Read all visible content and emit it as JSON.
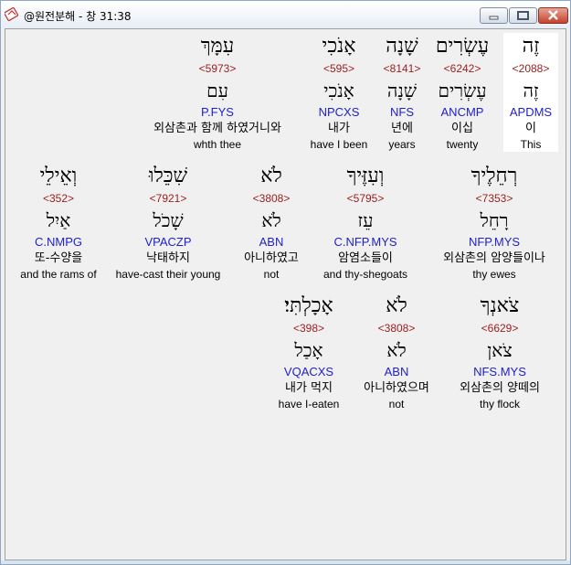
{
  "window": {
    "title": "@원전분해 - 창 31:38",
    "icon": "app-logo-icon",
    "buttons": [
      "minimize-icon",
      "maximize-icon",
      "close-icon"
    ]
  },
  "rows": [
    [
      {
        "heb1": "זֶה",
        "strong": "<2088>",
        "heb2": "זֶה",
        "morph": "APDMS",
        "kor": "이",
        "eng": "This",
        "highlight": true
      },
      {
        "heb1": "עֶשְׂרִים",
        "strong": "<6242>",
        "heb2": "עֶשְׂרִים",
        "morph": "ANCMP",
        "kor": "이십",
        "eng": "twenty"
      },
      {
        "heb1": "שָׁנָה",
        "strong": "<8141>",
        "heb2": "שָׁנָה",
        "morph": "NFS",
        "kor": "년에",
        "eng": "years"
      },
      {
        "heb1": "אָנֹכִי",
        "strong": "<595>",
        "heb2": "אָנֹכִי",
        "morph": "NPCXS",
        "kor": "내가",
        "eng": "have I been"
      },
      {
        "heb1": "עִמָּךְ",
        "strong": "<5973>",
        "heb2": "עִם",
        "morph": "P.FYS",
        "kor": "외삼촌과 함께 하였거니와",
        "eng": "whth thee"
      }
    ],
    [
      {
        "heb1": "רְחֵלֶיךָ",
        "strong": "<7353>",
        "heb2": "רָחֵל",
        "morph": "NFP.MYS",
        "kor": "외삼촌의 암양들이나",
        "eng": "thy ewes"
      },
      {
        "heb1": "וְעִזֶּיךָ",
        "strong": "<5795>",
        "heb2": "עֵז",
        "morph": "C.NFP.MYS",
        "kor": "암염소들이",
        "eng": "and thy-shegoats"
      },
      {
        "heb1": "לֹא",
        "strong": "<3808>",
        "heb2": "לֹא",
        "morph": "ABN",
        "kor": "아니하였고",
        "eng": "not"
      },
      {
        "heb1": "שִׁכֵּלוּ",
        "strong": "<7921>",
        "heb2": "שָׁכֹל",
        "morph": "VPACZP",
        "kor": "낙태하지",
        "eng": "have-cast their young"
      },
      {
        "heb1": "וְאֵילֵי",
        "strong": "<352>",
        "heb2": "אַיִל",
        "morph": "C.NMPG",
        "kor": "또-수양을",
        "eng": "and the rams of"
      }
    ],
    [
      {
        "heb1": "צֹאנְךָ",
        "strong": "<6629>",
        "heb2": "צֹאן",
        "morph": "NFS.MYS",
        "kor": "외삼촌의 양떼의",
        "eng": "thy flock"
      },
      {
        "heb1": "לֹא",
        "strong": "<3808>",
        "heb2": "לֹא",
        "morph": "ABN",
        "kor": "아니하였으며",
        "eng": "not"
      },
      {
        "heb1": "אָכָלְתִּי׃",
        "strong": "<398>",
        "heb2": "אָכַל",
        "morph": "VQACXS",
        "kor": "내가 먹지",
        "eng": "have I-eaten"
      }
    ]
  ]
}
